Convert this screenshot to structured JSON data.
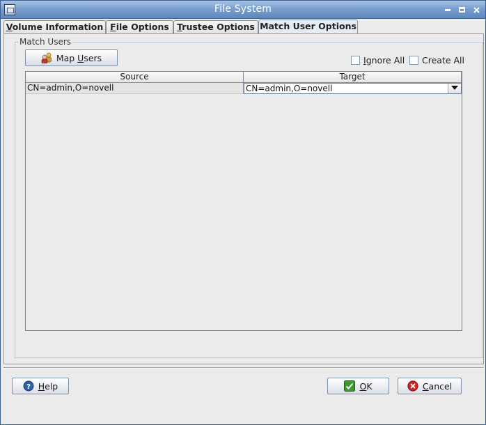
{
  "window": {
    "title": "File System"
  },
  "tabs": [
    {
      "label": "Volume Information",
      "mnemonic": "V",
      "rest": "olume Information",
      "active": false
    },
    {
      "label": "File Options",
      "mnemonic": "F",
      "rest": "ile Options",
      "active": false
    },
    {
      "label": "Trustee Options",
      "mnemonic": "T",
      "rest": "rustee Options",
      "active": false
    },
    {
      "label": "Match User Options",
      "mnemonic": "",
      "rest": "Match User Options",
      "active": true
    }
  ],
  "group": {
    "legend": "Match Users",
    "map_button": {
      "pre": "Map ",
      "mnemonic": "U",
      "rest": "sers",
      "icon": "users-icon"
    },
    "ignore_all": {
      "mnemonic": "I",
      "rest": "gnore All",
      "checked": false
    },
    "create_all": {
      "pre": "",
      "mnemonic": "",
      "rest": "Create All",
      "checked": false
    }
  },
  "table": {
    "columns": [
      "Source",
      "Target"
    ],
    "rows": [
      {
        "source": "CN=admin,O=novell",
        "target": "CN=admin,O=novell"
      }
    ]
  },
  "buttons": {
    "help": {
      "mnemonic": "H",
      "rest": "elp",
      "icon": "help-icon"
    },
    "ok": {
      "mnemonic": "O",
      "rest": "K",
      "icon": "check-icon"
    },
    "cancel": {
      "mnemonic": "C",
      "rest": "ancel",
      "icon": "cancel-icon"
    }
  },
  "colors": {
    "titlebar": "#7a9fcf",
    "ok_icon": "#3a9a2a",
    "cancel_icon": "#d02020",
    "help_icon": "#2f5fa8"
  }
}
